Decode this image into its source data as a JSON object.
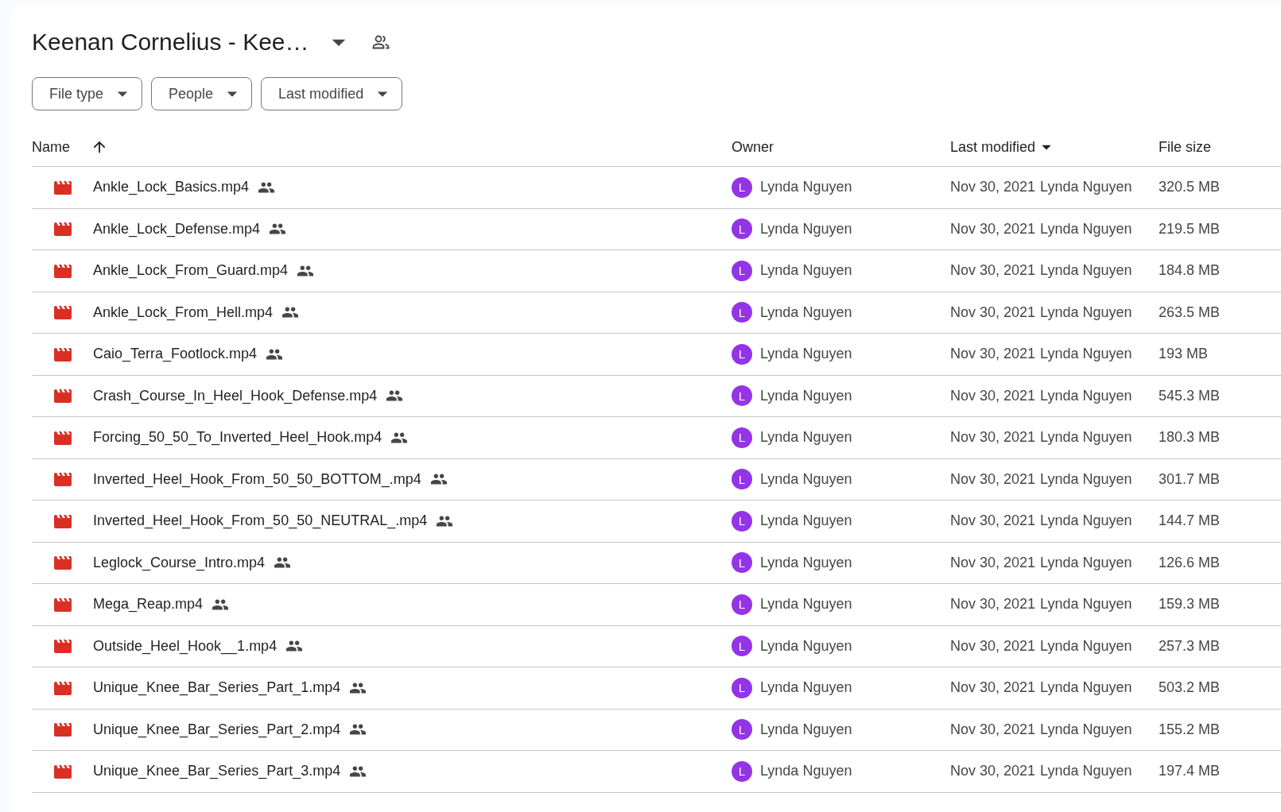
{
  "folder": {
    "title": "Keenan Cornelius - Kee…",
    "shared": true
  },
  "filters": [
    {
      "label": "File type"
    },
    {
      "label": "People"
    },
    {
      "label": "Last modified"
    }
  ],
  "table": {
    "columns": [
      {
        "label": "Name",
        "sort_arrow": true,
        "menu_caret": false
      },
      {
        "label": "Owner",
        "sort_arrow": false,
        "menu_caret": false
      },
      {
        "label": "Last modified",
        "sort_arrow": false,
        "menu_caret": true
      },
      {
        "label": "File size",
        "sort_arrow": false,
        "menu_caret": false
      }
    ],
    "rows": [
      {
        "name": "Ankle_Lock_Basics.mp4",
        "shared": true,
        "owner": "Lynda Nguyen",
        "owner_initial": "L",
        "color": "#9334e6",
        "modified": "Nov 30, 2021",
        "modified_by": "Lynda Nguyen",
        "size": "320.5 MB"
      },
      {
        "name": "Ankle_Lock_Defense.mp4",
        "shared": true,
        "owner": "Lynda Nguyen",
        "owner_initial": "L",
        "color": "#9334e6",
        "modified": "Nov 30, 2021",
        "modified_by": "Lynda Nguyen",
        "size": "219.5 MB"
      },
      {
        "name": "Ankle_Lock_From_Guard.mp4",
        "shared": true,
        "owner": "Lynda Nguyen",
        "owner_initial": "L",
        "color": "#9334e6",
        "modified": "Nov 30, 2021",
        "modified_by": "Lynda Nguyen",
        "size": "184.8 MB"
      },
      {
        "name": "Ankle_Lock_From_Hell.mp4",
        "shared": true,
        "owner": "Lynda Nguyen",
        "owner_initial": "L",
        "color": "#9334e6",
        "modified": "Nov 30, 2021",
        "modified_by": "Lynda Nguyen",
        "size": "263.5 MB"
      },
      {
        "name": "Caio_Terra_Footlock.mp4",
        "shared": true,
        "owner": "Lynda Nguyen",
        "owner_initial": "L",
        "color": "#9334e6",
        "modified": "Nov 30, 2021",
        "modified_by": "Lynda Nguyen",
        "size": "193 MB"
      },
      {
        "name": "Crash_Course_In_Heel_Hook_Defense.mp4",
        "shared": true,
        "owner": "Lynda Nguyen",
        "owner_initial": "L",
        "color": "#9334e6",
        "modified": "Nov 30, 2021",
        "modified_by": "Lynda Nguyen",
        "size": "545.3 MB"
      },
      {
        "name": "Forcing_50_50_To_Inverted_Heel_Hook.mp4",
        "shared": true,
        "owner": "Lynda Nguyen",
        "owner_initial": "L",
        "color": "#9334e6",
        "modified": "Nov 30, 2021",
        "modified_by": "Lynda Nguyen",
        "size": "180.3 MB"
      },
      {
        "name": "Inverted_Heel_Hook_From_50_50_BOTTOM_.mp4",
        "shared": true,
        "owner": "Lynda Nguyen",
        "owner_initial": "L",
        "color": "#9334e6",
        "modified": "Nov 30, 2021",
        "modified_by": "Lynda Nguyen",
        "size": "301.7 MB"
      },
      {
        "name": "Inverted_Heel_Hook_From_50_50_NEUTRAL_.mp4",
        "shared": true,
        "owner": "Lynda Nguyen",
        "owner_initial": "L",
        "color": "#9334e6",
        "modified": "Nov 30, 2021",
        "modified_by": "Lynda Nguyen",
        "size": "144.7 MB"
      },
      {
        "name": "Leglock_Course_Intro.mp4",
        "shared": true,
        "owner": "Lynda Nguyen",
        "owner_initial": "L",
        "color": "#9334e6",
        "modified": "Nov 30, 2021",
        "modified_by": "Lynda Nguyen",
        "size": "126.6 MB"
      },
      {
        "name": "Mega_Reap.mp4",
        "shared": true,
        "owner": "Lynda Nguyen",
        "owner_initial": "L",
        "color": "#9334e6",
        "modified": "Nov 30, 2021",
        "modified_by": "Lynda Nguyen",
        "size": "159.3 MB"
      },
      {
        "name": "Outside_Heel_Hook__1.mp4",
        "shared": true,
        "owner": "Lynda Nguyen",
        "owner_initial": "L",
        "color": "#9334e6",
        "modified": "Nov 30, 2021",
        "modified_by": "Lynda Nguyen",
        "size": "257.3 MB"
      },
      {
        "name": "Unique_Knee_Bar_Series_Part_1.mp4",
        "shared": true,
        "owner": "Lynda Nguyen",
        "owner_initial": "L",
        "color": "#9334e6",
        "modified": "Nov 30, 2021",
        "modified_by": "Lynda Nguyen",
        "size": "503.2 MB"
      },
      {
        "name": "Unique_Knee_Bar_Series_Part_2.mp4",
        "shared": true,
        "owner": "Lynda Nguyen",
        "owner_initial": "L",
        "color": "#9334e6",
        "modified": "Nov 30, 2021",
        "modified_by": "Lynda Nguyen",
        "size": "155.2 MB"
      },
      {
        "name": "Unique_Knee_Bar_Series_Part_3.mp4",
        "shared": true,
        "owner": "Lynda Nguyen",
        "owner_initial": "L",
        "color": "#9334e6",
        "modified": "Nov 30, 2021",
        "modified_by": "Lynda Nguyen",
        "size": "197.4 MB"
      }
    ]
  }
}
